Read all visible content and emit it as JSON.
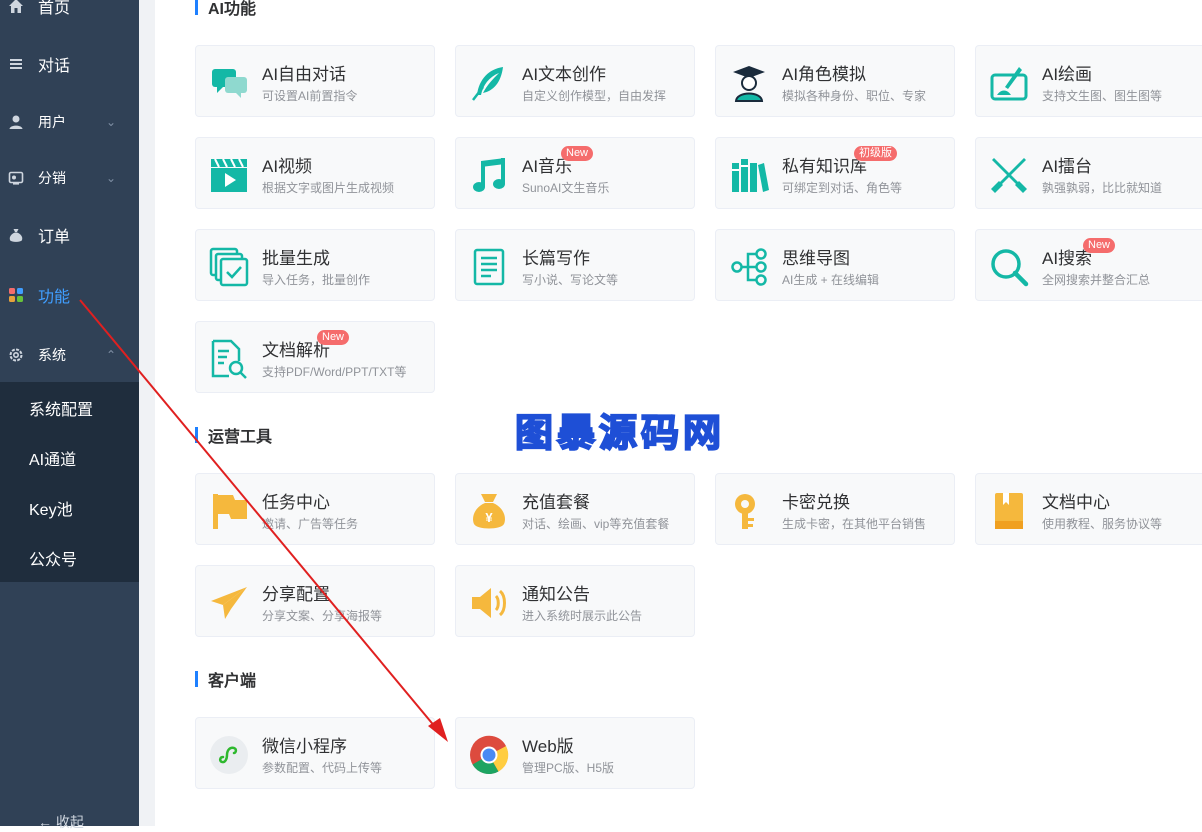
{
  "sidebar": {
    "items": [
      {
        "label": "首页",
        "icon": "home-icon"
      },
      {
        "label": "对话",
        "icon": "list-icon"
      },
      {
        "label": "用户",
        "icon": "user-icon"
      },
      {
        "label": "分销",
        "icon": "share-icon"
      },
      {
        "label": "订单",
        "icon": "money-bag-icon"
      },
      {
        "label": "功能",
        "icon": "grid-icon",
        "active": true
      },
      {
        "label": "系统",
        "icon": "gear-icon"
      }
    ],
    "submenu": [
      "系统配置",
      "AI通道",
      "Key池",
      "公众号"
    ],
    "collapse_label": "收起"
  },
  "sections": {
    "ai": {
      "title": "AI功能",
      "cards": [
        {
          "title": "AI自由对话",
          "desc": "可设置AI前置指令"
        },
        {
          "title": "AI文本创作",
          "desc": "自定义创作模型，自由发挥"
        },
        {
          "title": "AI角色模拟",
          "desc": "模拟各种身份、职位、专家"
        },
        {
          "title": "AI绘画",
          "desc": "支持文生图、图生图等"
        },
        {
          "title": "AI视频",
          "desc": "根据文字或图片生成视频"
        },
        {
          "title": "AI音乐",
          "desc": "SunoAI文生音乐",
          "badge": "New"
        },
        {
          "title": "私有知识库",
          "desc": "可绑定到对话、角色等",
          "badge": "初级版"
        },
        {
          "title": "AI擂台",
          "desc": "孰强孰弱，比比就知道"
        },
        {
          "title": "批量生成",
          "desc": "导入任务，批量创作"
        },
        {
          "title": "长篇写作",
          "desc": "写小说、写论文等"
        },
        {
          "title": "思维导图",
          "desc": "AI生成 + 在线编辑"
        },
        {
          "title": "AI搜索",
          "desc": "全网搜索并整合汇总",
          "badge": "New"
        },
        {
          "title": "文档解析",
          "desc": "支持PDF/Word/PPT/TXT等",
          "badge": "New"
        }
      ]
    },
    "ops": {
      "title": "运营工具",
      "cards": [
        {
          "title": "任务中心",
          "desc": "邀请、广告等任务"
        },
        {
          "title": "充值套餐",
          "desc": "对话、绘画、vip等充值套餐"
        },
        {
          "title": "卡密兑换",
          "desc": "生成卡密，在其他平台销售"
        },
        {
          "title": "文档中心",
          "desc": "使用教程、服务协议等"
        },
        {
          "title": "分享配置",
          "desc": "分享文案、分享海报等"
        },
        {
          "title": "通知公告",
          "desc": "进入系统时展示此公告"
        }
      ]
    },
    "client": {
      "title": "客户端",
      "cards": [
        {
          "title": "微信小程序",
          "desc": "参数配置、代码上传等"
        },
        {
          "title": "Web版",
          "desc": "管理PC版、H5版"
        }
      ]
    }
  },
  "watermark": "图暴源码网",
  "colors": {
    "sidebar_bg": "#304156",
    "submenu_bg": "#1f2d3d",
    "accent": "#1e80ff",
    "teal": "#14b8a6",
    "orange": "#f5b83d",
    "badge": "#f56c6c",
    "arrow": "#e02020"
  }
}
